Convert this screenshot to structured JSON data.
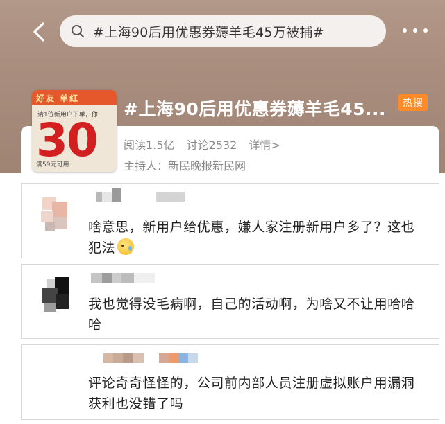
{
  "search": {
    "query": "#上海90后用优惠券薅羊毛45万被捕#"
  },
  "topic": {
    "title": "#上海90后用优惠券薅羊毛45...",
    "hot_badge": "热搜",
    "reads": "阅读1.5亿",
    "discussions": "讨论2532",
    "details": "详情>",
    "host": "主持人：新民晚报新民网",
    "thumbnail": {
      "banner": "好友 单红",
      "line": "请1位新用户下单，你",
      "number": "30",
      "note": "满59元可用"
    }
  },
  "comments": [
    {
      "text": "啥意思，新用户给优惠，嫌人家注册新用户多了？这也犯法",
      "emoji": "sweat-smile-emoji"
    },
    {
      "text": "我也觉得没毛病啊，自己的活动啊，为啥又不让用哈哈哈"
    },
    {
      "text": "评论奇奇怪怪的，公司前内部人员注册虚拟账户用漏洞获利也没错了吗"
    }
  ],
  "colors": {
    "header_bg": "#a88c7d",
    "hot_badge": "#ff8a2a",
    "meta_text": "#888888"
  }
}
